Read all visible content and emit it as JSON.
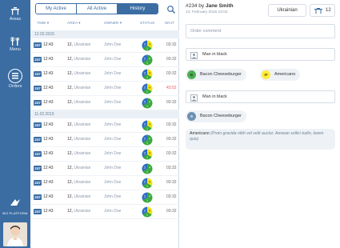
{
  "sidebar": {
    "items": [
      {
        "label": "Areas",
        "icon": "areas-icon"
      },
      {
        "label": "Menu",
        "icon": "menu-icon"
      },
      {
        "label": "Orders",
        "icon": "orders-icon"
      }
    ],
    "brand": "BIZ PLATFORM",
    "colors": {
      "sidebar": "#3b6da3",
      "accent": "#3b6da3"
    }
  },
  "tabs": [
    {
      "label": "My Active",
      "active": false
    },
    {
      "label": "All Active",
      "active": false
    },
    {
      "label": "History",
      "active": true
    }
  ],
  "columns": {
    "time": "TIME",
    "area": "AREA",
    "owner": "OWNER",
    "status": "STATUS",
    "wait": "WAIT"
  },
  "groups": [
    {
      "date": "12.02.2015",
      "rows": [
        {
          "badge": "247",
          "time": "12:43",
          "area": "12,",
          "area_sub": "Ukrainian",
          "owner": "John Doe",
          "wait": "03:32",
          "alert": false,
          "status": [
            "yellow",
            "green",
            "blue"
          ]
        },
        {
          "badge": "247",
          "time": "12:43",
          "area": "12,",
          "area_sub": "Ukrainian",
          "owner": "John Doe",
          "wait": "03:32",
          "alert": false,
          "status": [
            "green",
            "green",
            "blue"
          ]
        },
        {
          "badge": "247",
          "time": "12:43",
          "area": "12,",
          "area_sub": "Ukrainian",
          "owner": "John Doe",
          "wait": "03:32",
          "alert": false,
          "status": [
            "yellow",
            "green",
            "blue"
          ]
        },
        {
          "badge": "247",
          "time": "12:43",
          "area": "12,",
          "area_sub": "Ukrainian",
          "owner": "John Doe",
          "wait": "43:52",
          "alert": true,
          "status": [
            "yellow",
            "green",
            "blue"
          ]
        },
        {
          "badge": "247",
          "time": "12:43",
          "area": "12,",
          "area_sub": "Ukrainian",
          "owner": "John Doe",
          "wait": "03:32",
          "alert": false,
          "status": [
            "green",
            "green",
            "blue"
          ]
        }
      ]
    },
    {
      "date": "11.02.2015",
      "rows": [
        {
          "badge": "247",
          "time": "12:43",
          "area": "12,",
          "area_sub": "Ukrainian",
          "owner": "John Doe",
          "wait": "03:32",
          "alert": false,
          "status": [
            "yellow",
            "green",
            "blue"
          ]
        },
        {
          "badge": "247",
          "time": "12:43",
          "area": "12,",
          "area_sub": "Ukrainian",
          "owner": "John Doe",
          "wait": "03:32",
          "alert": false,
          "status": [
            "green",
            "green",
            "blue"
          ]
        },
        {
          "badge": "247",
          "time": "12:43",
          "area": "12,",
          "area_sub": "Ukrainian",
          "owner": "John Doe",
          "wait": "03:32",
          "alert": false,
          "status": [
            "yellow",
            "green",
            "blue"
          ]
        },
        {
          "badge": "247",
          "time": "12:43",
          "area": "12,",
          "area_sub": "Ukrainian",
          "owner": "John Doe",
          "wait": "03:32",
          "alert": false,
          "status": [
            "green",
            "green",
            "blue"
          ]
        },
        {
          "badge": "247",
          "time": "12:43",
          "area": "12,",
          "area_sub": "Ukrainian",
          "owner": "John Doe",
          "wait": "03:32",
          "alert": false,
          "status": [
            "yellow",
            "green",
            "blue"
          ]
        },
        {
          "badge": "247",
          "time": "12:43",
          "area": "12,",
          "area_sub": "Ukrainian",
          "owner": "John Doe",
          "wait": "03:32",
          "alert": false,
          "status": [
            "green",
            "green",
            "blue"
          ]
        },
        {
          "badge": "247",
          "time": "12:43",
          "area": "12,",
          "area_sub": "Ukrainian",
          "owner": "John Doe",
          "wait": "03:32",
          "alert": false,
          "status": [
            "yellow",
            "green",
            "blue"
          ]
        }
      ]
    }
  ],
  "status_digits": [
    "4",
    "1",
    "2"
  ],
  "detail": {
    "order_no": "#234",
    "by_label": "by",
    "owner": "Jane Smith",
    "datetime": "13, February 2015 23:02",
    "language": "Ukrainian",
    "table_no": "12",
    "comment_placeholder": "Order comment",
    "guests": [
      {
        "name": "Man in black",
        "items": [
          {
            "badge": "B",
            "label": "Bacon Cheeseburger",
            "color": "#4caf50"
          },
          {
            "badge": "IP",
            "label": "Americano",
            "color": "#ffeb3b"
          }
        ]
      },
      {
        "name": "Man in black",
        "items": [
          {
            "badge": "S",
            "label": "Bacon Cheeseburger",
            "color": "#6d8fb3"
          }
        ]
      }
    ],
    "note_title": "Americano",
    "note_text": "(Proin gravida nibh vel velit auctor. Aenean sollici tudin, lorem quis)"
  },
  "colors": {
    "yellow": "#f2e20f",
    "green": "#36a83b",
    "blue": "#2f6fc2",
    "alert": "#e8555b"
  }
}
